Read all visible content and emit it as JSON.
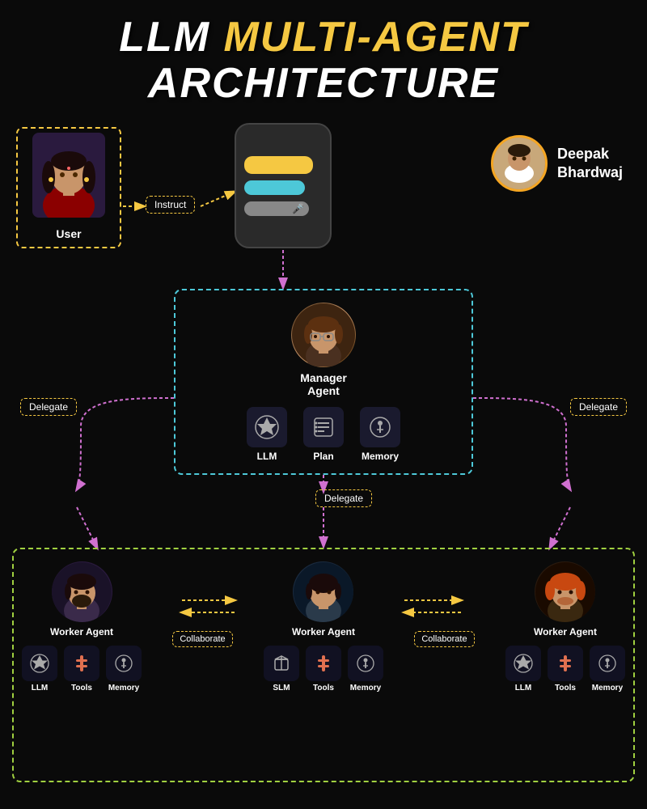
{
  "title": {
    "line1_white": "LLM",
    "line1_yellow": "MULTI-AGENT",
    "line2": "ARCHITECTURE"
  },
  "author": {
    "name_line1": "Deepak",
    "name_line2": "Bhardwaj"
  },
  "user": {
    "label": "User"
  },
  "instruct": {
    "label": "Instruct"
  },
  "manager": {
    "label_line1": "Manager",
    "label_line2": "Agent",
    "tools": [
      {
        "icon": "⚙️",
        "label": "LLM",
        "symbol": "openai"
      },
      {
        "icon": "📋",
        "label": "Plan",
        "symbol": "plan"
      },
      {
        "icon": "🧠",
        "label": "Memory",
        "symbol": "memory"
      }
    ]
  },
  "delegate_labels": {
    "left": "Delegate",
    "right": "Delegate",
    "bottom": "Delegate"
  },
  "workers": [
    {
      "label": "Worker Agent",
      "tools": [
        {
          "label": "LLM",
          "symbol": "openai"
        },
        {
          "label": "Tools",
          "symbol": "tools"
        },
        {
          "label": "Memory",
          "symbol": "memory"
        }
      ]
    },
    {
      "label": "Worker Agent",
      "tools": [
        {
          "label": "SLM",
          "symbol": "box"
        },
        {
          "label": "Tools",
          "symbol": "tools"
        },
        {
          "label": "Memory",
          "symbol": "memory"
        }
      ]
    },
    {
      "label": "Worker Agent",
      "tools": [
        {
          "label": "LLM",
          "symbol": "openai"
        },
        {
          "label": "Tools",
          "symbol": "tools"
        },
        {
          "label": "Memory",
          "symbol": "memory"
        }
      ]
    }
  ],
  "collaborate_labels": {
    "left": "Collaborate",
    "right": "Collaborate"
  }
}
